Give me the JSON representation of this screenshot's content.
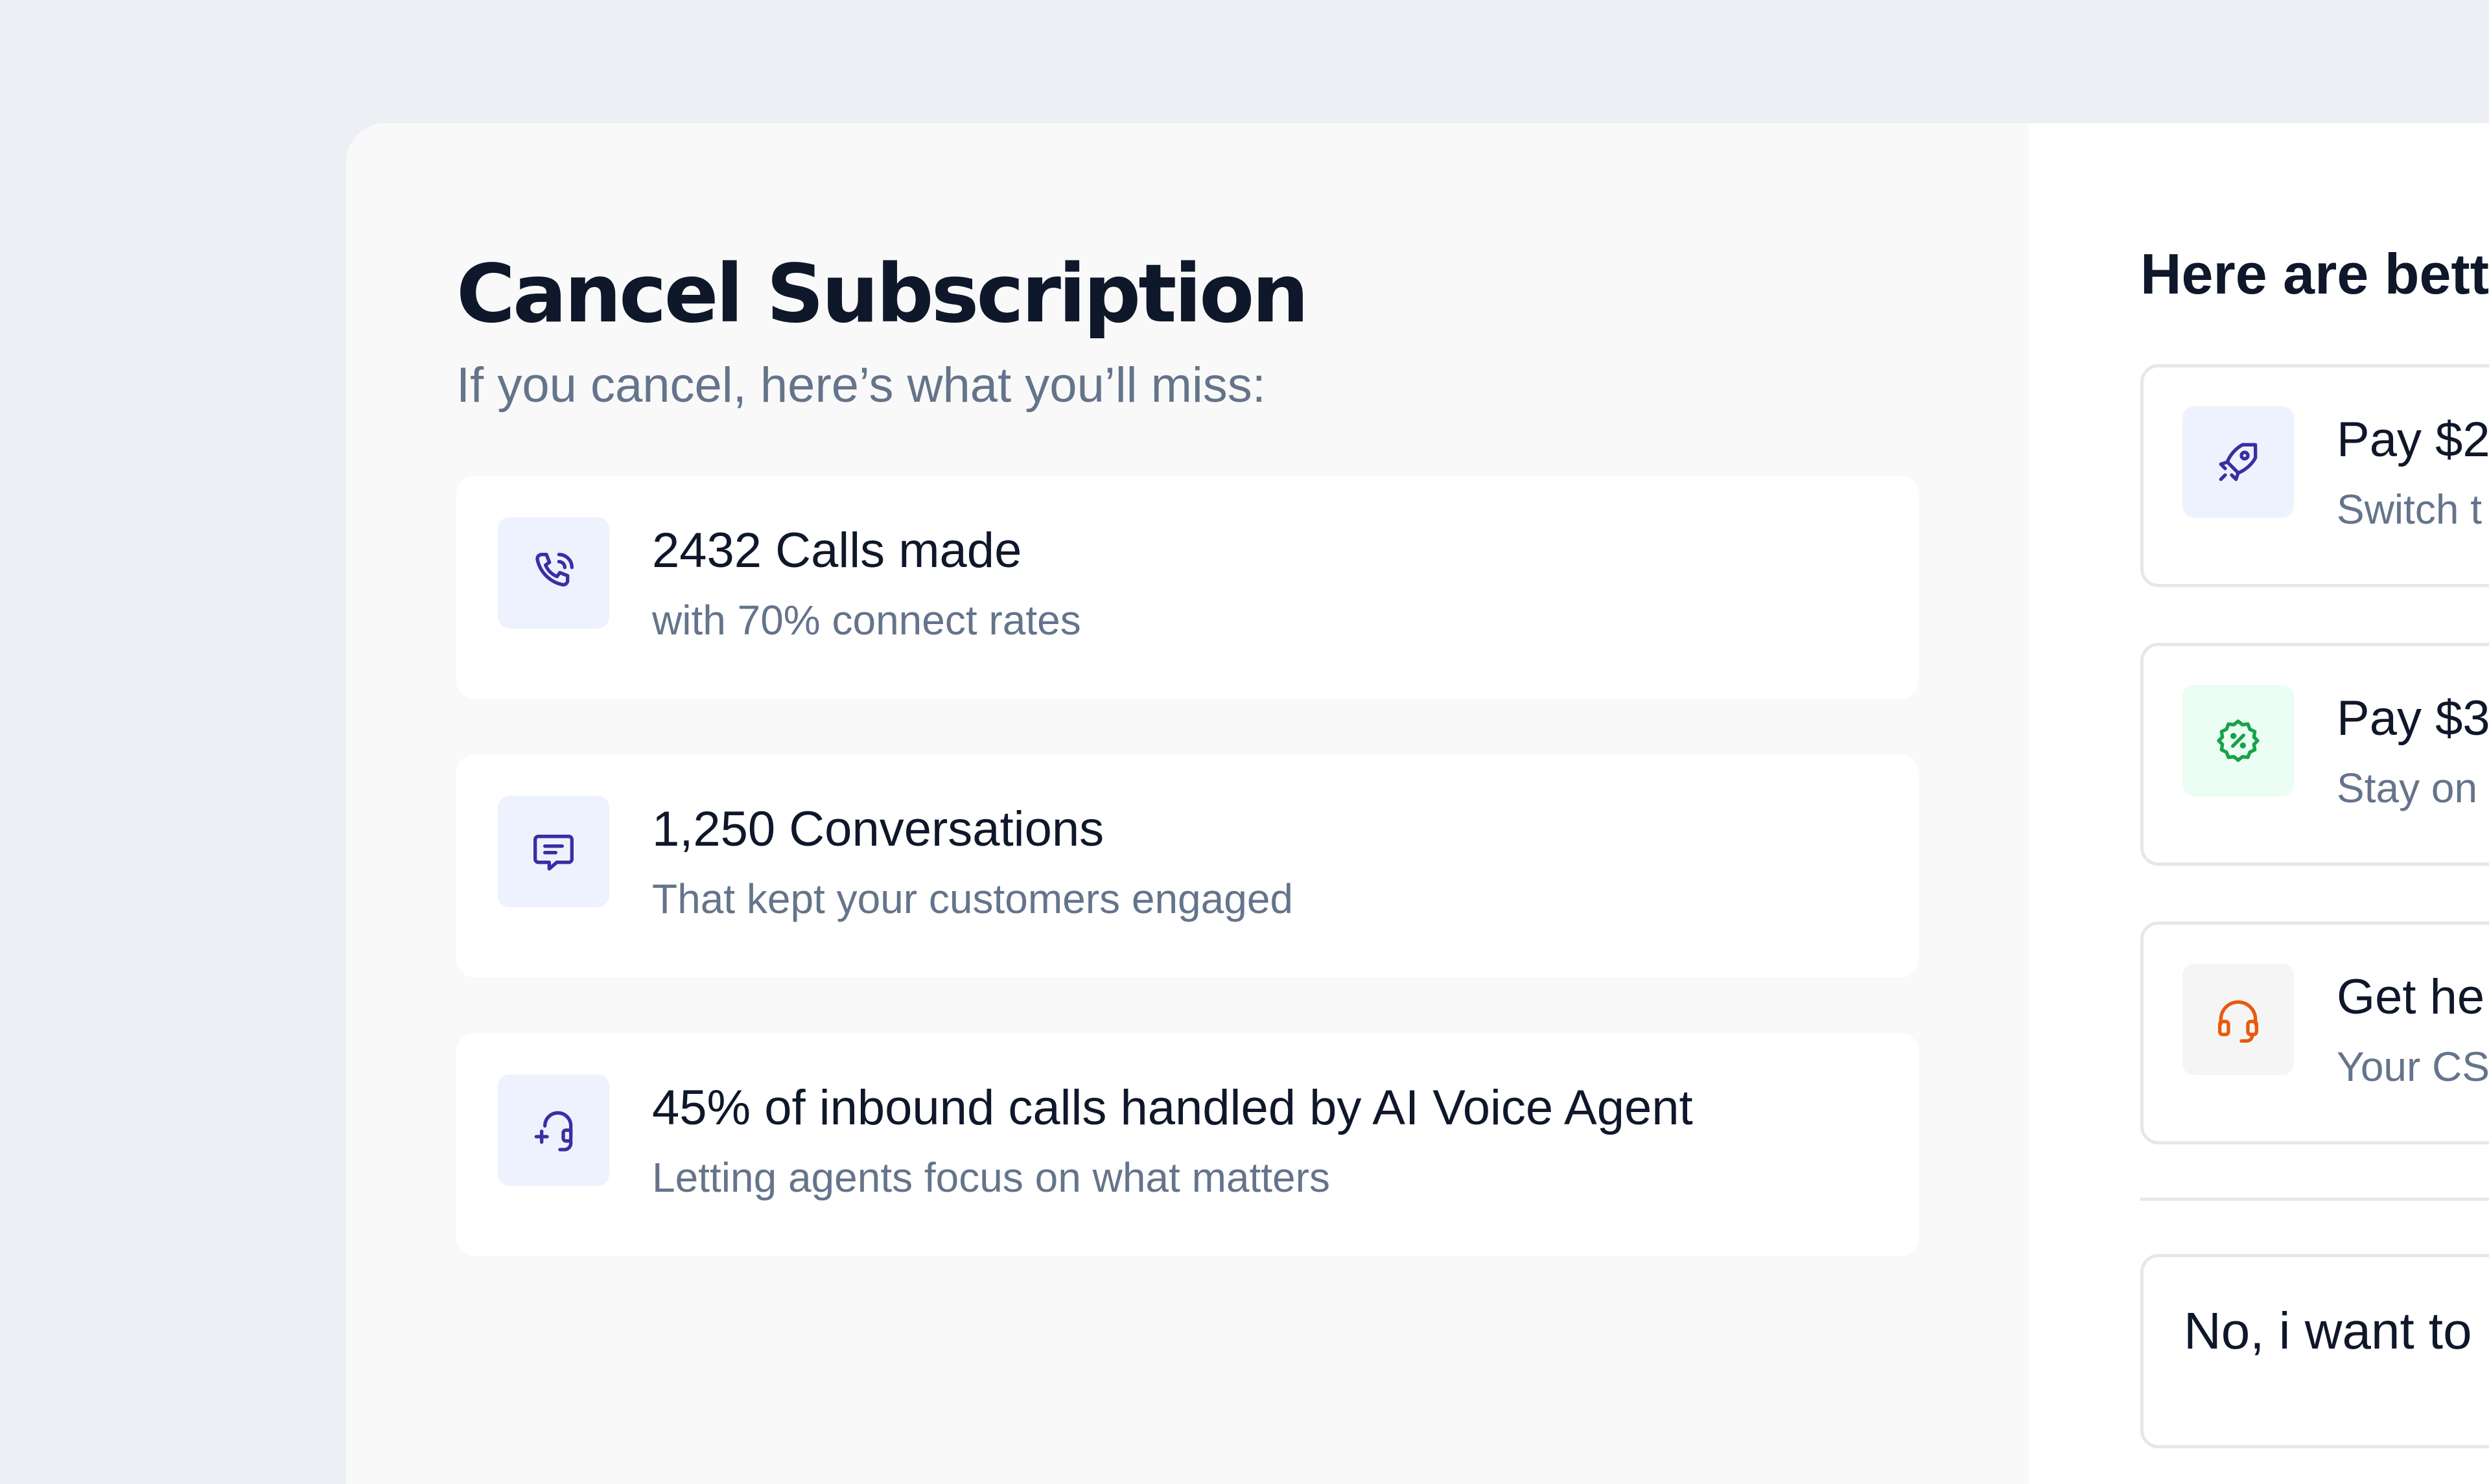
{
  "modal": {
    "title": "Cancel Subscription",
    "subtitle": "If you cancel, here’s what you’ll miss:"
  },
  "stats": [
    {
      "icon": "phone-icon",
      "title": "2432 Calls made",
      "subtitle": "with 70% connect rates"
    },
    {
      "icon": "chat-icon",
      "title": "1,250 Conversations",
      "subtitle": "That kept your customers engaged"
    },
    {
      "icon": "ai-headset-icon",
      "title": "45% of inbound calls handled by AI Voice Agent",
      "subtitle": "Letting agents focus on what matters"
    }
  ],
  "offers": {
    "heading": "Here are bett",
    "items": [
      {
        "icon": "rocket-icon",
        "title": "Pay $2",
        "subtitle": "Switch t",
        "icon_bg": "#EEF2FF",
        "icon_color": "#3730A3"
      },
      {
        "icon": "discount-badge-icon",
        "title": "Pay $3",
        "subtitle": "Stay on",
        "icon_bg": "#ECFDF3",
        "icon_color": "#16A34A"
      },
      {
        "icon": "headset-icon",
        "title": "Get he",
        "subtitle": "Your CS",
        "icon_bg": "#F5F5F5",
        "icon_color": "#EA580C"
      }
    ],
    "decline_label": "No, i want to"
  },
  "colors": {
    "background": "#ECEFF4",
    "accent_icon": "#3730A3",
    "title_text": "#0F172A",
    "muted_text": "#64748B"
  }
}
